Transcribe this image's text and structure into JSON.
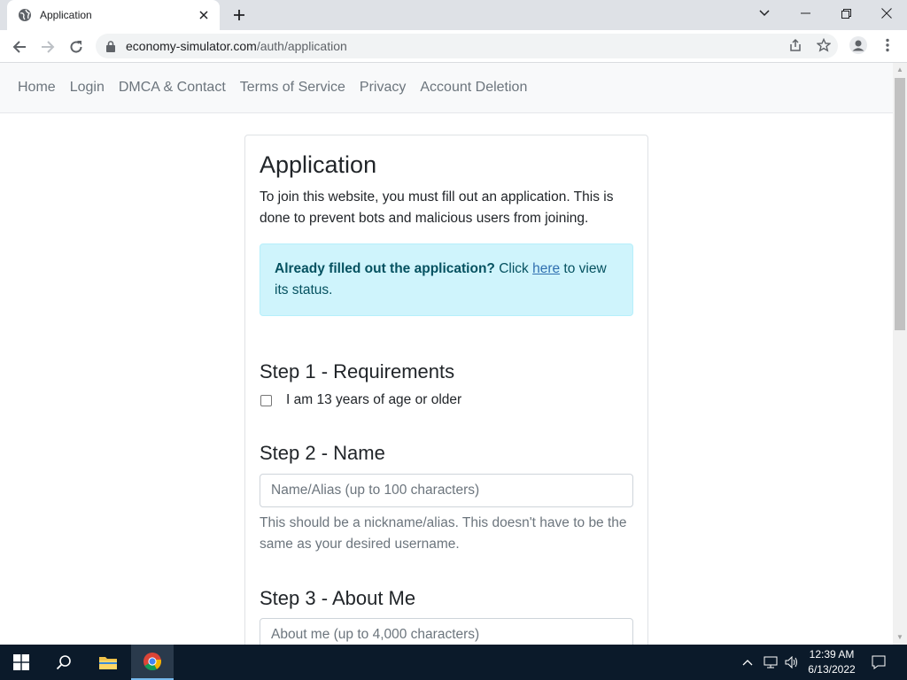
{
  "browser": {
    "tab_title": "Application",
    "url_host": "economy-simulator.com",
    "url_path": "/auth/application"
  },
  "nav": {
    "items": [
      {
        "label": "Home"
      },
      {
        "label": "Login"
      },
      {
        "label": "DMCA & Contact"
      },
      {
        "label": "Terms of Service"
      },
      {
        "label": "Privacy"
      },
      {
        "label": "Account Deletion"
      }
    ]
  },
  "card": {
    "title": "Application",
    "intro": "To join this website, you must fill out an application. This is done to prevent bots and malicious users from joining.",
    "alert": {
      "bold": "Already filled out the application?",
      "before_link": " Click ",
      "link": "here",
      "after_link": " to view its status."
    },
    "step1": {
      "heading": "Step 1 - Requirements",
      "checkbox_label": "I am 13 years of age or older",
      "checked": false
    },
    "step2": {
      "heading": "Step 2 - Name",
      "placeholder": "Name/Alias (up to 100 characters)",
      "help": "This should be a nickname/alias. This doesn't have to be the same as your desired username."
    },
    "step3": {
      "heading": "Step 3 - About Me",
      "placeholder": "About me (up to 4,000 characters)"
    }
  },
  "taskbar": {
    "time": "12:39 AM",
    "date": "6/13/2022"
  }
}
